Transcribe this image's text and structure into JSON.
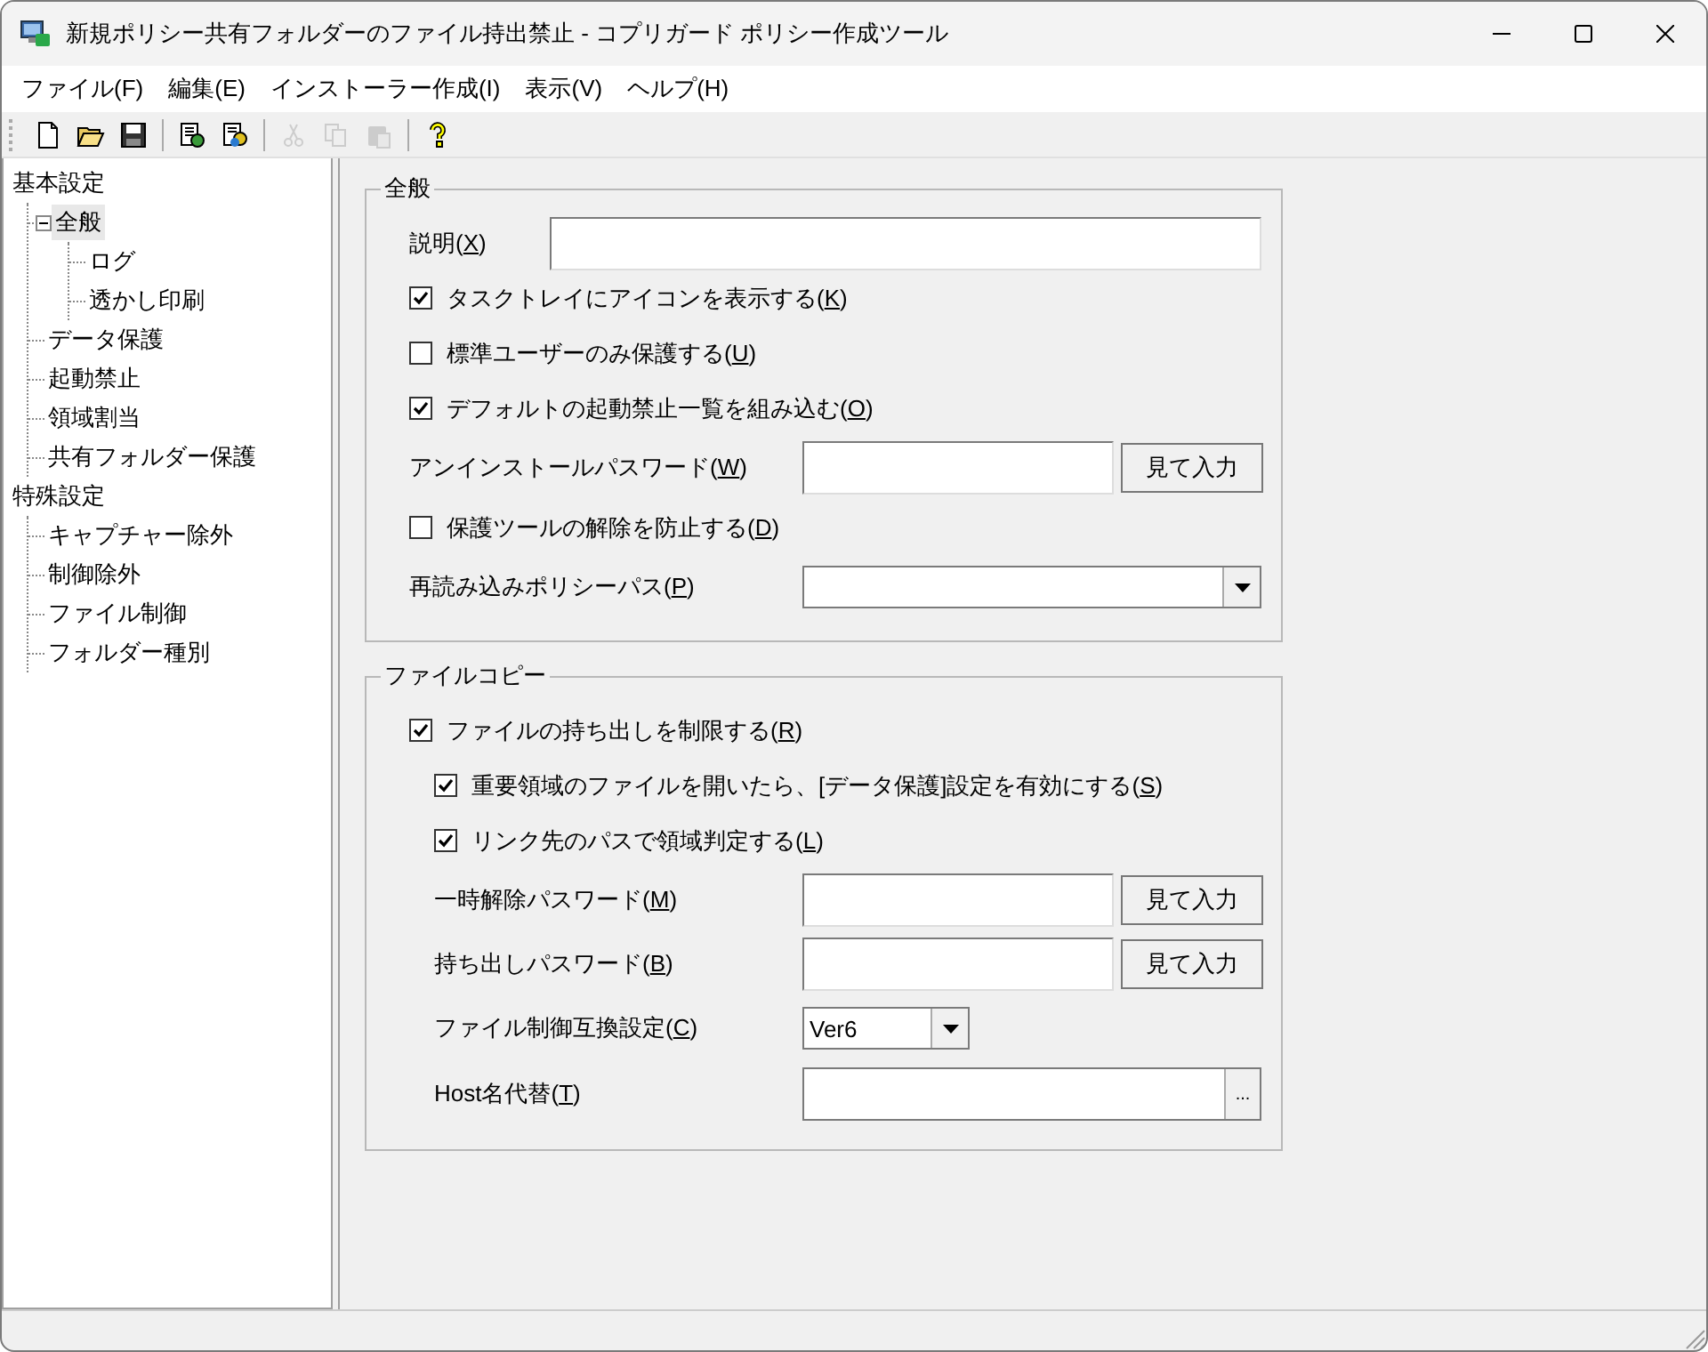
{
  "window": {
    "title": "新規ポリシー共有フォルダーのファイル持出禁止 - コプリガード ポリシー作成ツール"
  },
  "menu": [
    "ファイル(F)",
    "編集(E)",
    "インストーラー作成(I)",
    "表示(V)",
    "ヘルプ(H)"
  ],
  "toolbar": [
    {
      "kind": "new",
      "disabled": false
    },
    {
      "kind": "open",
      "disabled": false
    },
    {
      "kind": "save",
      "disabled": false
    },
    {
      "kind": "separator"
    },
    {
      "kind": "policy",
      "disabled": false
    },
    {
      "kind": "policy2",
      "disabled": false
    },
    {
      "kind": "separator"
    },
    {
      "kind": "cut",
      "disabled": true
    },
    {
      "kind": "copy",
      "disabled": true
    },
    {
      "kind": "paste",
      "disabled": true
    },
    {
      "kind": "separator"
    },
    {
      "kind": "help",
      "disabled": false
    }
  ],
  "tree": [
    {
      "label": "基本設定",
      "selected": false,
      "children": [
        {
          "label": "全般",
          "selected": true,
          "expanded": true,
          "children": [
            {
              "label": "ログ",
              "selected": false
            },
            {
              "label": "透かし印刷",
              "selected": false
            }
          ]
        },
        {
          "label": "データ保護",
          "selected": false
        },
        {
          "label": "起動禁止",
          "selected": false
        },
        {
          "label": "領域割当",
          "selected": false
        },
        {
          "label": "共有フォルダー保護",
          "selected": false
        }
      ]
    },
    {
      "label": "特殊設定",
      "selected": false,
      "children": [
        {
          "label": "キャプチャー除外",
          "selected": false
        },
        {
          "label": "制御除外",
          "selected": false
        },
        {
          "label": "ファイル制御",
          "selected": false
        },
        {
          "label": "フォルダー種別",
          "selected": false
        }
      ]
    }
  ],
  "groups": [
    {
      "title": "全般",
      "rows": [
        {
          "kind": "text",
          "label": "説明(X)"
        },
        {
          "kind": "checkbox",
          "label": "タスクトレイにアイコンを表示する(K)",
          "checked": true
        },
        {
          "kind": "checkbox",
          "label": "標準ユーザーのみ保護する(U)",
          "checked": false
        },
        {
          "kind": "checkbox",
          "label": "デフォルトの起動禁止一覧を組み込む(O)",
          "checked": true
        },
        {
          "kind": "password",
          "label": "アンインストールパスワード(W)",
          "button": "見て入力"
        },
        {
          "kind": "checkbox",
          "label": "保護ツールの解除を防止する(D)",
          "checked": false
        },
        {
          "kind": "combo",
          "label": "再読み込みポリシーパス(P)"
        }
      ]
    },
    {
      "title": "ファイルコピー",
      "rows": [
        {
          "kind": "checkbox",
          "label": "ファイルの持ち出しを制限する(R)",
          "checked": true,
          "children": [
            {
              "kind": "checkbox",
              "label": "重要領域のファイルを開いたら、[データ保護]設定を有効にする(S)",
              "checked": true
            },
            {
              "kind": "checkbox",
              "label": "リンク先のパスで領域判定する(L)",
              "checked": true
            },
            {
              "kind": "password",
              "label": "一時解除パスワード(M)",
              "button": "見て入力"
            },
            {
              "kind": "password",
              "label": "持ち出しパスワード(B)",
              "button": "見て入力"
            },
            {
              "kind": "smallcombo",
              "label": "ファイル制御互換設定(C)",
              "value": "Ver6"
            },
            {
              "kind": "browse",
              "label": "Host名代替(T)",
              "button": "..."
            }
          ]
        }
      ]
    }
  ]
}
